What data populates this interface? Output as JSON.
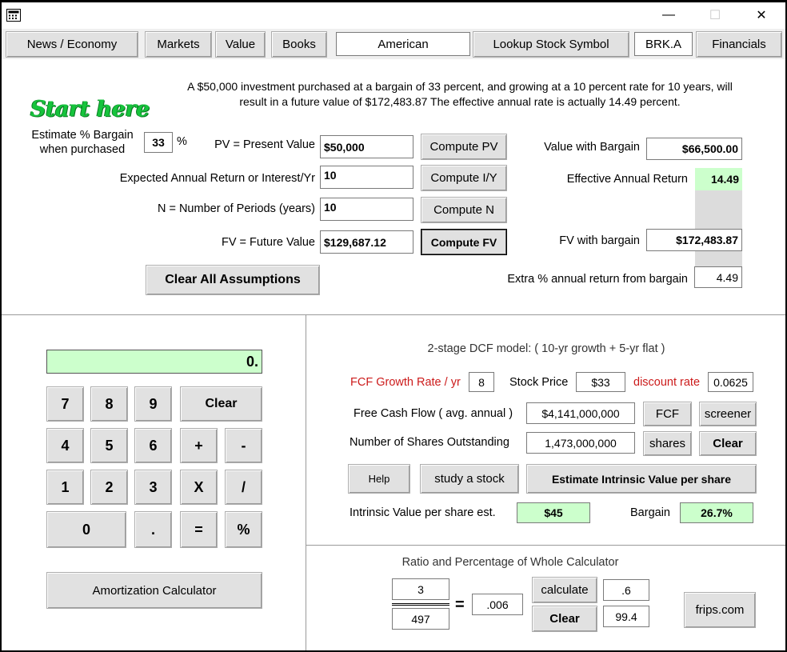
{
  "nav": {
    "news": "News / Economy",
    "markets": "Markets",
    "value": "Value",
    "books": "Books",
    "exchange": "American",
    "lookup": "Lookup Stock Symbol",
    "symbol": "BRK.A",
    "financials": "Financials"
  },
  "window_controls": {
    "minimize": "—",
    "maximize": "☐",
    "close": "✕"
  },
  "summary": "A $50,000 investment purchased at a bargain of 33 percent, and growing at a 10 percent rate for 10 years, will result in a future value of $172,483.87 The effective annual rate is actually 14.49 percent.",
  "tvm": {
    "start_here": "Start here",
    "bargain_label_1": "Estimate % Bargain",
    "bargain_label_2": "when purchased",
    "bargain_value": "33",
    "percent_sign": "%",
    "pv_label": "PV = Present Value",
    "pv_value": "$50,000",
    "compute_pv": "Compute PV",
    "iy_label": "Expected Annual Return or Interest/Yr",
    "iy_value": "10",
    "compute_iy": "Compute I/Y",
    "n_label": "N = Number of Periods (years)",
    "n_value": "10",
    "compute_n": "Compute N",
    "fv_label": "FV = Future Value",
    "fv_value": "$129,687.12",
    "compute_fv": "Compute FV",
    "clear_all": "Clear All Assumptions",
    "value_with_bargain_label": "Value with Bargain",
    "value_with_bargain": "$66,500.00",
    "effective_return_label": "Effective Annual Return",
    "effective_return": "14.49",
    "fv_with_bargain_label": "FV with bargain",
    "fv_with_bargain": "$172,483.87",
    "extra_return_label": "Extra % annual return from bargain",
    "extra_return": "4.49"
  },
  "calculator": {
    "display": "0.",
    "keys": {
      "k7": "7",
      "k8": "8",
      "k9": "9",
      "clear": "Clear",
      "k4": "4",
      "k5": "5",
      "k6": "6",
      "plus": "+",
      "minus": "-",
      "k1": "1",
      "k2": "2",
      "k3": "3",
      "times": "X",
      "divide": "/",
      "k0": "0",
      "dot": ".",
      "equals": "=",
      "percent": "%"
    },
    "amortization": "Amortization Calculator"
  },
  "dcf": {
    "title": "2-stage DCF model:  ( 10-yr growth + 5-yr flat )",
    "growth_label": "FCF Growth Rate / yr",
    "growth_value": "8",
    "price_label": "Stock Price",
    "price_value": "$33",
    "discount_label": "discount rate",
    "discount_value": "0.0625",
    "fcf_label": "Free Cash Flow ( avg. annual )",
    "fcf_value": "$4,141,000,000",
    "fcf_button": "FCF",
    "screener_button": "screener",
    "shares_label": "Number of Shares Outstanding",
    "shares_value": "1,473,000,000",
    "shares_button": "shares",
    "clear_button": "Clear",
    "help_button": "Help",
    "study_button": "study a stock",
    "estimate_button": "Estimate Intrinsic Value per share",
    "intrinsic_label": "Intrinsic Value  per share est.",
    "intrinsic_value": "$45",
    "bargain_label": "Bargain",
    "bargain_value": "26.7%"
  },
  "ratio": {
    "title": "Ratio and Percentage of Whole Calculator",
    "numerator": "3",
    "denominator": "497",
    "equals": "=",
    "result": ".006",
    "calculate_button": "calculate",
    "clear_button": "Clear",
    "percent_part": ".6",
    "percent_rest": "99.4",
    "frips": "frips.com"
  }
}
